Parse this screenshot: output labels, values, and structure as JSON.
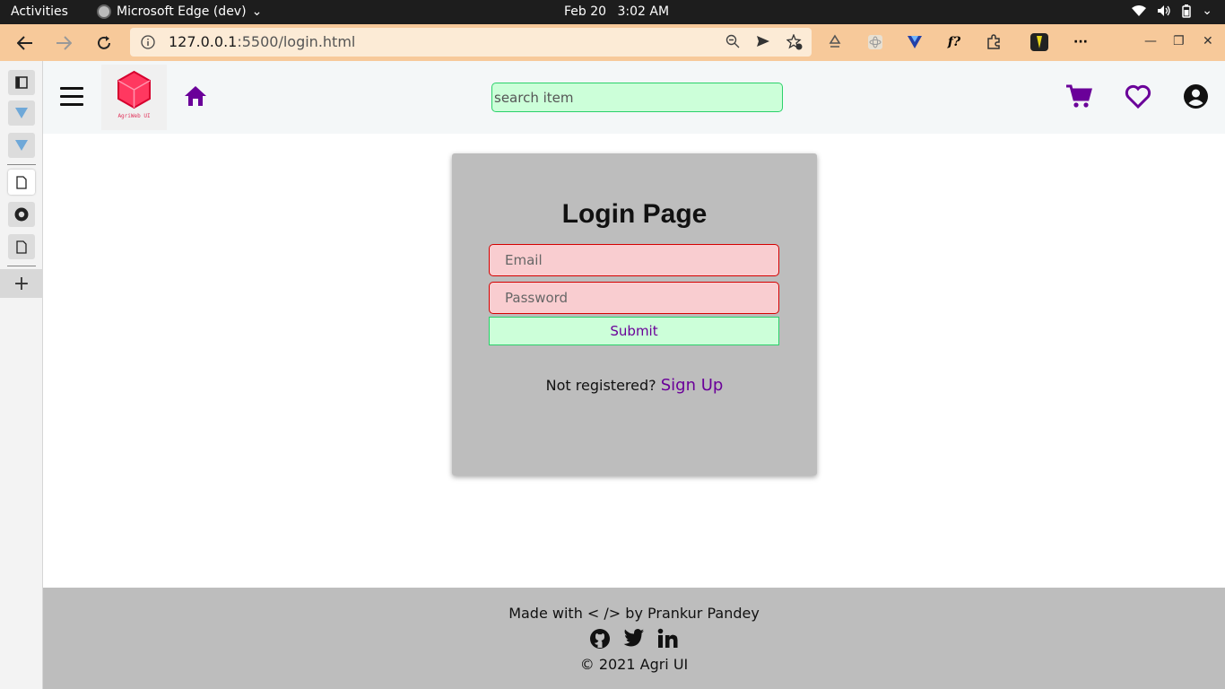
{
  "os_bar": {
    "activities": "Activities",
    "app_name": "Microsoft Edge (dev)",
    "date": "Feb 20",
    "time": "3:02 AM"
  },
  "browser": {
    "url_host": "127.0.0.1",
    "url_path": ":5500/login.html",
    "more_label": "···"
  },
  "site": {
    "logo_caption": "AgriWeb UI",
    "search_placeholder": "search item",
    "accent_color": "#6a0099"
  },
  "login": {
    "title": "Login Page",
    "email_placeholder": "Email",
    "password_placeholder": "Password",
    "submit_label": "Submit",
    "not_registered": "Not registered?",
    "signup_link": "Sign Up"
  },
  "footer": {
    "made_with": "Made with < /> by Prankur Pandey",
    "copyright": "© 2021 Agri UI"
  }
}
